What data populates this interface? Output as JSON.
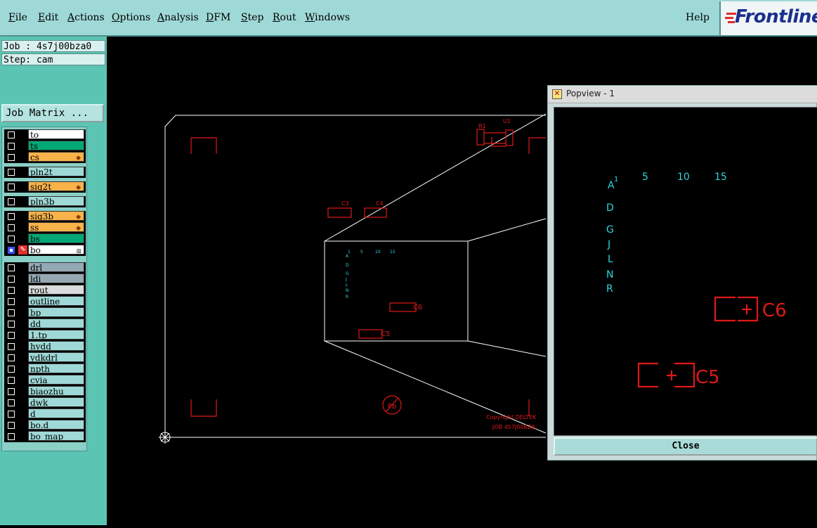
{
  "menubar": {
    "items": [
      "File",
      "Edit",
      "Actions",
      "Options",
      "Analysis",
      "DFM",
      "Step",
      "Rout",
      "Windows"
    ],
    "help": "Help"
  },
  "logo": {
    "text": "Frontline"
  },
  "job_info": {
    "job": "Job : 4s7j00bza0",
    "step": "Step: cam"
  },
  "job_matrix_button": "Job Matrix ...",
  "layer_groups": [
    [
      {
        "name": "to",
        "color": "#ffffff"
      },
      {
        "name": "ts",
        "color": "#00a876"
      },
      {
        "name": "cs",
        "color": "#f7b24a",
        "flame": true
      }
    ],
    [
      {
        "name": "pln2t",
        "color": "#9fd9d7"
      }
    ],
    [
      {
        "name": "sig2t",
        "color": "#f7b24a",
        "flame": true
      }
    ],
    [
      {
        "name": "pln3b",
        "color": "#9fd9d7"
      }
    ],
    [
      {
        "name": "sig3b",
        "color": "#f7b24a",
        "flame": true
      },
      {
        "name": "ss",
        "color": "#f7b24a",
        "flame": true
      },
      {
        "name": "bs",
        "color": "#00a876"
      },
      {
        "name": "bo",
        "color": "#ffffff",
        "active": true
      }
    ],
    [
      {
        "name": "drl",
        "color": "#95a9b4"
      },
      {
        "name": "ldi",
        "color": "#95a9b4"
      },
      {
        "name": "rout",
        "color": "#d8dcdc"
      }
    ],
    [
      {
        "name": "outline",
        "color": "#9fd9d7"
      },
      {
        "name": "bp",
        "color": "#9fd9d7"
      },
      {
        "name": "dd",
        "color": "#9fd9d7"
      },
      {
        "name": "1.tp",
        "color": "#9fd9d7"
      },
      {
        "name": "hydd",
        "color": "#9fd9d7"
      },
      {
        "name": "ydkdrl",
        "color": "#9fd9d7"
      },
      {
        "name": "npth",
        "color": "#9fd9d7"
      },
      {
        "name": "cvia",
        "color": "#9fd9d7"
      },
      {
        "name": "biaozhu",
        "color": "#9fd9d7"
      },
      {
        "name": "dwk",
        "color": "#9fd9d7"
      },
      {
        "name": "d",
        "color": "#9fd9d7"
      },
      {
        "name": "bo.d",
        "color": "#9fd9d7"
      },
      {
        "name": "bo_map",
        "color": "#9fd9d7"
      }
    ]
  ],
  "board_labels": {
    "r1": "R1",
    "u1": "U1",
    "c3": "C3",
    "c4": "C4",
    "c6": "C6",
    "c5": "C5",
    "copyright": "Copyright DELTEK",
    "job_code": "JOB 4S7J00BZA",
    "pb": "Pb"
  },
  "popview": {
    "title": "Popview - 1",
    "close_label": "Close",
    "numbers": [
      "1",
      "5",
      "10",
      "15"
    ],
    "letters": [
      "A",
      "D",
      "G",
      "J",
      "L",
      "N",
      "R"
    ],
    "c6": "C6",
    "c5": "C5"
  },
  "colors": {
    "menubar": "#9fd9d7",
    "sidebar": "#5cc4b3",
    "board_outline": "#ffffff",
    "component_red": "#e01818",
    "marker_cyan": "#2fd3e0"
  }
}
